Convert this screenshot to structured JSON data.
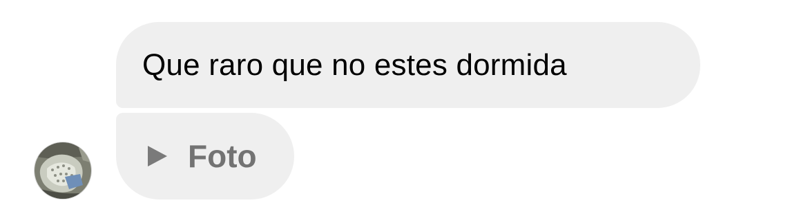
{
  "messages": [
    {
      "text": "Que raro que no estes dormida"
    },
    {
      "label": "Foto",
      "icon": "play-icon"
    }
  ],
  "sender": {
    "avatar_icon": "avatar-photo"
  },
  "colors": {
    "bubble_background": "#efefef",
    "text": "#000000",
    "muted_label": "#737373"
  }
}
